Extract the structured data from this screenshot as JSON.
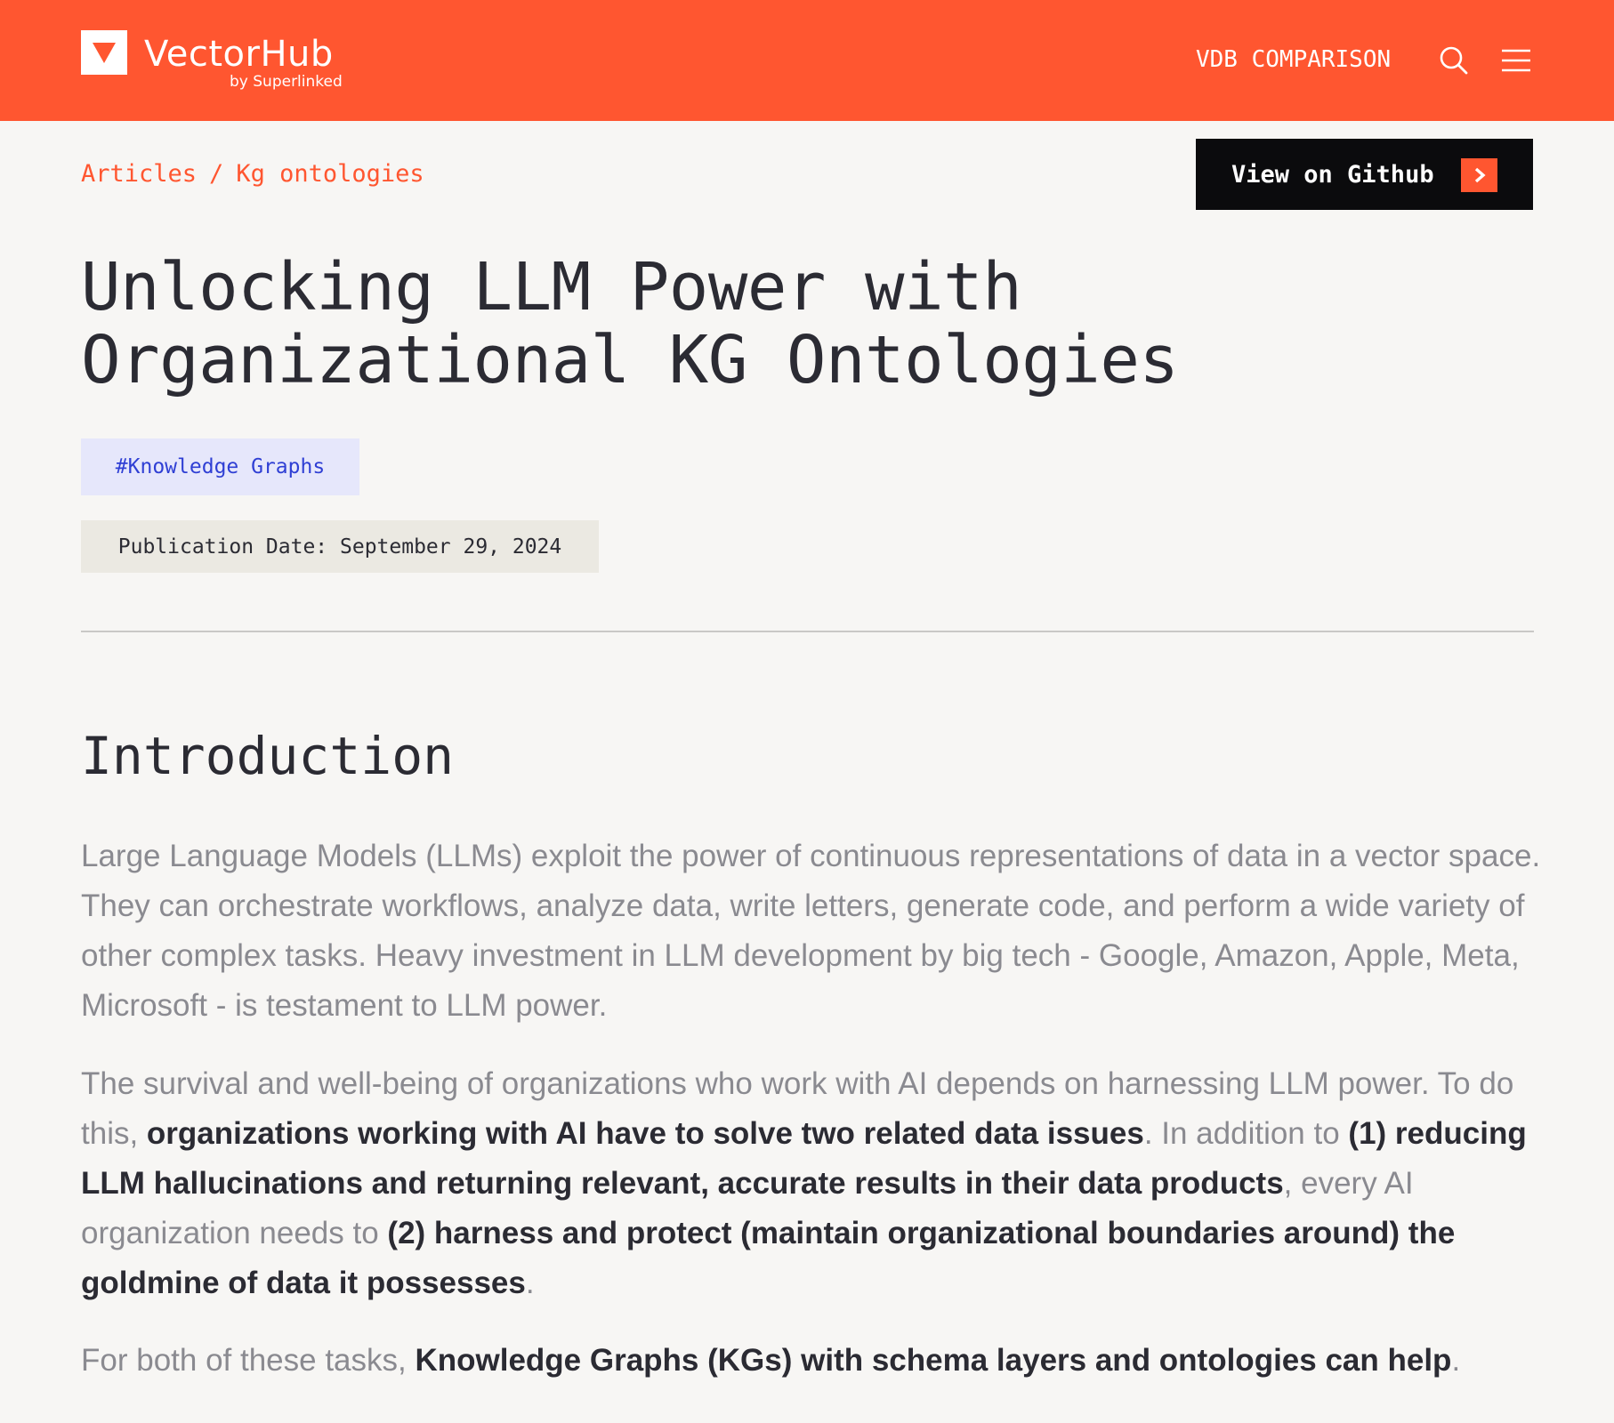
{
  "header": {
    "logo_name": "VectorHub",
    "logo_sub": "by Superlinked",
    "nav_link": "VDB COMPARISON",
    "brand_color": "#ff5630",
    "icons": [
      "search-icon",
      "menu-icon"
    ]
  },
  "breadcrumb": {
    "items": [
      "Articles",
      "Kg ontologies"
    ],
    "separator": "/"
  },
  "github_button": {
    "label": "View on Github",
    "icon": "arrow-right-icon"
  },
  "article": {
    "title": "Unlocking LLM Power with Organizational KG Ontologies",
    "tag": "#Knowledge Graphs",
    "publication_date": "Publication Date: September 29, 2024",
    "section_heading": "Introduction",
    "paragraphs": [
      {
        "segments": [
          {
            "text": "Large Language Models (LLMs) exploit the power of continuous representations of data in a vector space. They can orchestrate workflows, analyze data, write letters, generate code, and perform a wide variety of other complex tasks. Heavy investment in LLM development by big tech - Google, Amazon, Apple, Meta, Microsoft - is testament to LLM power.",
            "bold": false
          }
        ]
      },
      {
        "segments": [
          {
            "text": "The survival and well-being of organizations who work with AI depends on harnessing LLM power. To do this, ",
            "bold": false
          },
          {
            "text": "organizations working with AI have to solve two related data issues",
            "bold": true
          },
          {
            "text": ". In addition to ",
            "bold": false
          },
          {
            "text": "(1) reducing LLM hallucinations and returning relevant, accurate results in their data products",
            "bold": true
          },
          {
            "text": ", every AI organization needs to ",
            "bold": false
          },
          {
            "text": "(2) harness and protect (maintain organizational boundaries around) the goldmine of data it possesses",
            "bold": true
          },
          {
            "text": ".",
            "bold": false
          }
        ]
      },
      {
        "segments": [
          {
            "text": "For both of these tasks, ",
            "bold": false
          },
          {
            "text": "Knowledge Graphs (KGs) with schema layers and ontologies can help",
            "bold": true
          },
          {
            "text": ".",
            "bold": false
          }
        ]
      }
    ]
  }
}
